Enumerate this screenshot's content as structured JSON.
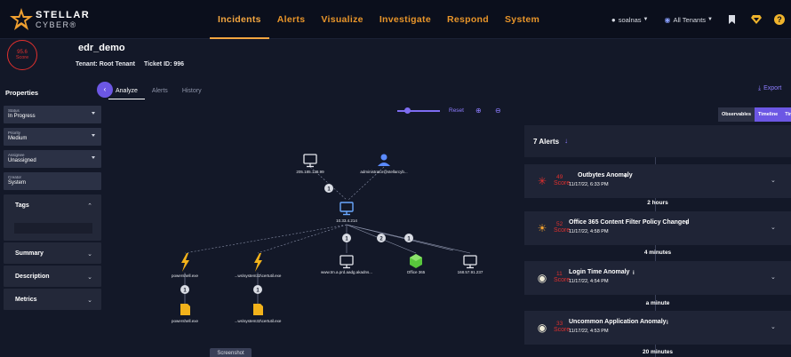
{
  "brand": {
    "name": "STELLAR",
    "sub": "CYBER®"
  },
  "nav": [
    "Incidents",
    "Alerts",
    "Visualize",
    "Investigate",
    "Respond",
    "System"
  ],
  "top_right": {
    "user": "soalnas",
    "tenant": "All Tenants"
  },
  "incident": {
    "score_value": "95.6",
    "score_label": "Score",
    "title": "edr_demo",
    "tenant": "Tenant: Root Tenant",
    "ticket": "Ticket ID: 996"
  },
  "properties": {
    "title": "Properties",
    "fields": [
      {
        "label": "Status",
        "value": "In Progress",
        "dropdown": true
      },
      {
        "label": "Priority",
        "value": "Medium",
        "dropdown": true
      },
      {
        "label": "Assignee",
        "value": "Unassigned",
        "dropdown": true
      },
      {
        "label": "Creator",
        "value": "System",
        "dropdown": false
      }
    ],
    "sections": [
      "Tags",
      "Summary",
      "Description",
      "Metrics"
    ]
  },
  "tabs": [
    "Analyze",
    "Alerts",
    "History"
  ],
  "export_label": "Export",
  "toolbar": {
    "reset": "Reset"
  },
  "graph": {
    "nodes": {
      "ip_top": "205.185.128.99",
      "admin": "administrator@stellarcyb...",
      "host": "10.33.4.214",
      "ps1": "powershell.exe",
      "cert1": "...ws\\system32\\certutil.exe",
      "web": "www.tm.a.prd.aadg.akadns...",
      "office": "Office 365",
      "ip_right": "168.57.91.237",
      "ps2": "powershell.exe",
      "cert2": "...ws\\system32\\certutil.exe"
    },
    "edge_counts": {
      "admin_host": "1",
      "host_web": "1",
      "host_office": "2",
      "host_ip": "1",
      "ps": "1",
      "cert": "1"
    }
  },
  "screenshot_label": "Screenshot",
  "view_toggle": [
    "Observables",
    "Timeline",
    "Tim"
  ],
  "alerts_panel": {
    "count_label": "7 Alerts",
    "score_word": "Score",
    "alerts": [
      {
        "score": "49",
        "title": "Outbytes Anomaly",
        "time": "11/17/22, 6:33 PM",
        "icon": "burst"
      },
      {
        "score": "52",
        "title": "Office 365 Content Filter Policy Changed",
        "time": "11/17/22, 4:58 PM",
        "icon": "hawk"
      },
      {
        "score": "11",
        "title": "Login Time Anomaly",
        "time": "11/17/22, 4:54 PM",
        "icon": "binoculars"
      },
      {
        "score": "33",
        "title": "Uncommon Application Anomaly",
        "time": "11/17/22, 4:53 PM",
        "icon": "binoculars"
      }
    ],
    "gaps": [
      "2 hours",
      "4 minutes",
      "a minute",
      "20 minutes"
    ]
  },
  "colors": {
    "accent": "#6c57e4",
    "nav": "#e8952a",
    "danger": "#e0302e",
    "node": "#6a7bff",
    "exe": "#f2b21b",
    "office": "#58c63c"
  }
}
